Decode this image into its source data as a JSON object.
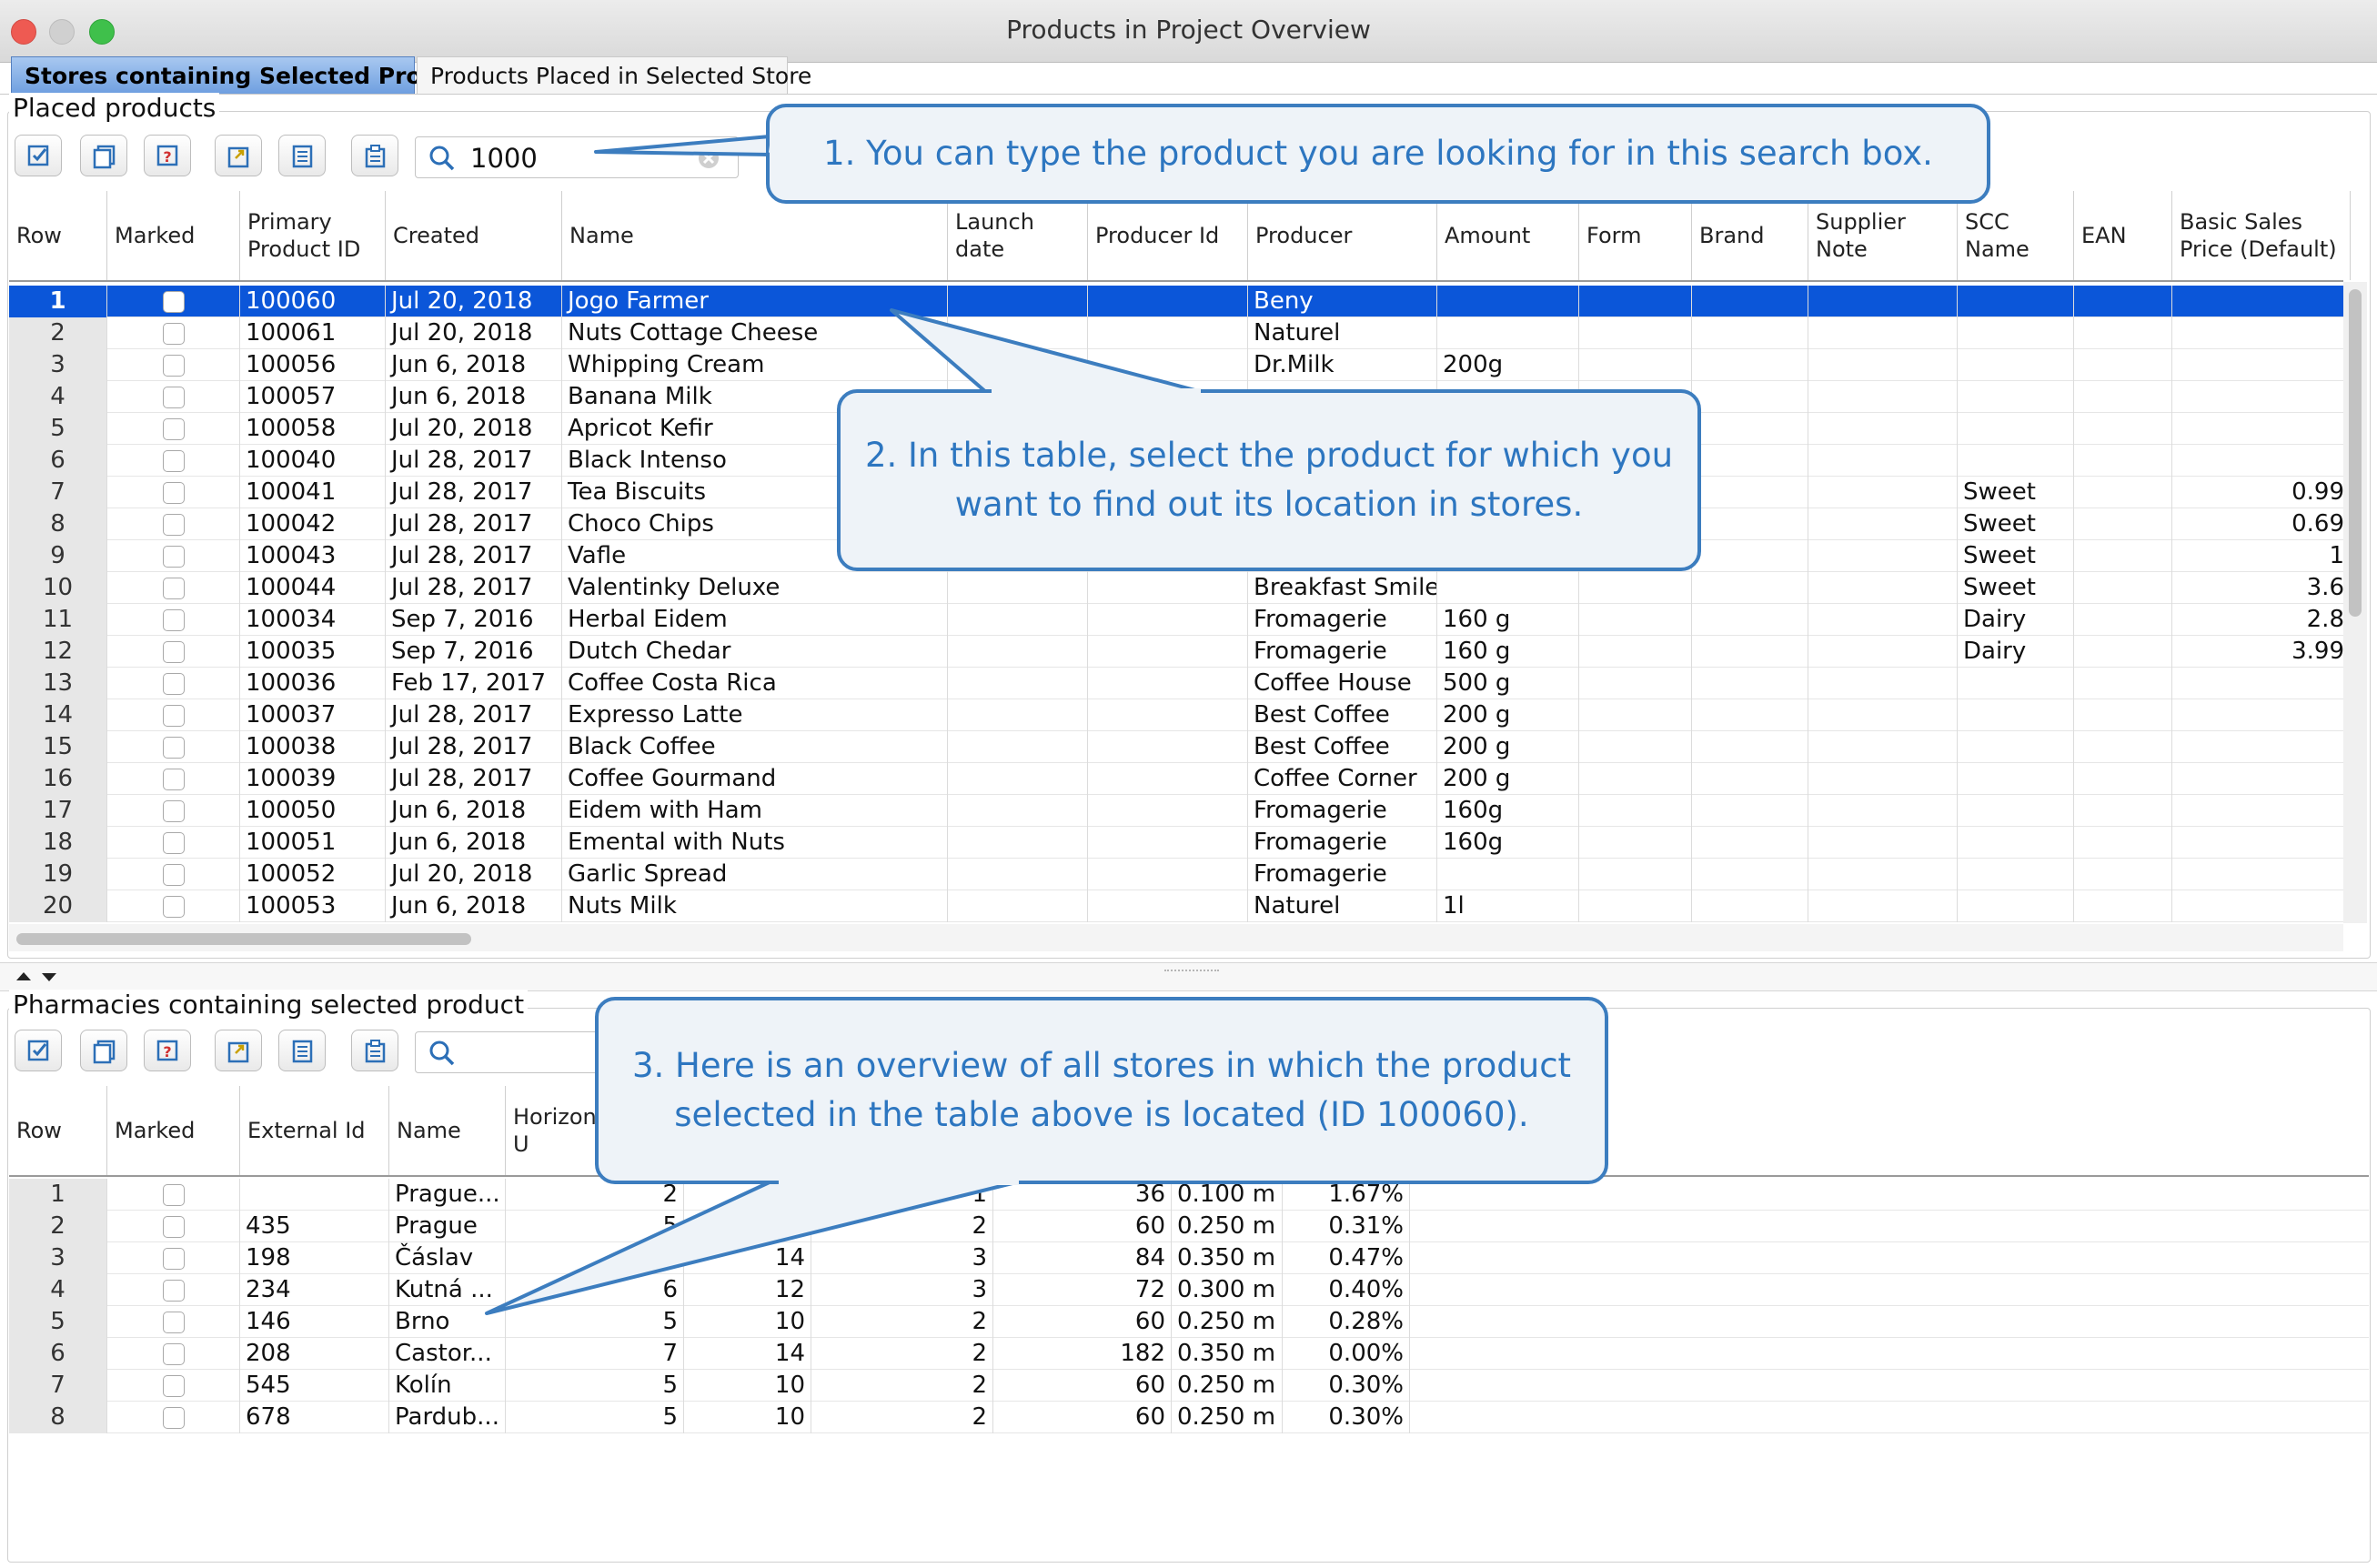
{
  "window": {
    "title": "Products in Project Overview"
  },
  "tabs": [
    {
      "label": "Stores containing Selected Product",
      "active": true
    },
    {
      "label": "Products Placed in Selected Store",
      "active": false
    }
  ],
  "top_panel": {
    "group_title": "Placed products",
    "search_value": "1000",
    "columns": [
      "Row",
      "Marked",
      "Primary Product ID",
      "Created",
      "Name",
      "Launch date",
      "Producer Id",
      "Producer",
      "Amount",
      "Form",
      "Brand",
      "Supplier Note",
      "SCC Name",
      "EAN",
      "Basic Sales Price (Default)"
    ],
    "rows": [
      {
        "row": "1",
        "id": "100060",
        "created": "Jul 20, 2018",
        "name": "Jogo Farmer",
        "producer": "Beny",
        "amount": "",
        "scc": "",
        "price": "",
        "selected": true
      },
      {
        "row": "2",
        "id": "100061",
        "created": "Jul 20, 2018",
        "name": "Nuts Cottage Cheese",
        "producer": "Naturel",
        "amount": "",
        "scc": "",
        "price": ""
      },
      {
        "row": "3",
        "id": "100056",
        "created": "Jun 6, 2018",
        "name": "Whipping Cream",
        "producer": "Dr.Milk",
        "amount": "200g",
        "scc": "",
        "price": ""
      },
      {
        "row": "4",
        "id": "100057",
        "created": "Jun 6, 2018",
        "name": "Banana Milk",
        "producer": "",
        "amount": "",
        "scc": "",
        "price": ""
      },
      {
        "row": "5",
        "id": "100058",
        "created": "Jul 20, 2018",
        "name": "Apricot Kefir",
        "producer": "",
        "amount": "",
        "scc": "",
        "price": ""
      },
      {
        "row": "6",
        "id": "100040",
        "created": "Jul 28, 2017",
        "name": "Black Intenso",
        "producer": "",
        "amount": "",
        "scc": "",
        "price": ""
      },
      {
        "row": "7",
        "id": "100041",
        "created": "Jul 28, 2017",
        "name": "Tea Biscuits",
        "producer": "",
        "amount": "",
        "scc": "Sweet",
        "price": "0.99"
      },
      {
        "row": "8",
        "id": "100042",
        "created": "Jul 28, 2017",
        "name": "Choco Chips",
        "producer": "",
        "amount": "",
        "scc": "Sweet",
        "price": "0.69"
      },
      {
        "row": "9",
        "id": "100043",
        "created": "Jul 28, 2017",
        "name": "Vafle",
        "producer": "",
        "amount": "",
        "scc": "Sweet",
        "price": "1"
      },
      {
        "row": "10",
        "id": "100044",
        "created": "Jul 28, 2017",
        "name": "Valentinky Deluxe",
        "producer": "Breakfast Smile",
        "amount": "",
        "scc": "Sweet",
        "price": "3.6"
      },
      {
        "row": "11",
        "id": "100034",
        "created": "Sep 7, 2016",
        "name": "Herbal Eidem",
        "producer": "Fromagerie",
        "amount": "160 g",
        "scc": "Dairy",
        "price": "2.8"
      },
      {
        "row": "12",
        "id": "100035",
        "created": "Sep 7, 2016",
        "name": "Dutch Chedar",
        "producer": "Fromagerie",
        "amount": "160 g",
        "scc": "Dairy",
        "price": "3.99"
      },
      {
        "row": "13",
        "id": "100036",
        "created": "Feb 17, 2017",
        "name": "Coffee Costa Rica",
        "producer": "Coffee House",
        "amount": "500 g",
        "scc": "",
        "price": ""
      },
      {
        "row": "14",
        "id": "100037",
        "created": "Jul 28, 2017",
        "name": "Expresso Latte",
        "producer": "Best Coffee",
        "amount": "200 g",
        "scc": "",
        "price": ""
      },
      {
        "row": "15",
        "id": "100038",
        "created": "Jul 28, 2017",
        "name": "Black Coffee",
        "producer": "Best Coffee",
        "amount": "200 g",
        "scc": "",
        "price": ""
      },
      {
        "row": "16",
        "id": "100039",
        "created": "Jul 28, 2017",
        "name": "Coffee Gourmand",
        "producer": "Coffee Corner",
        "amount": "200 g",
        "scc": "",
        "price": ""
      },
      {
        "row": "17",
        "id": "100050",
        "created": "Jun 6, 2018",
        "name": "Eidem with Ham",
        "producer": "Fromagerie",
        "amount": "160g",
        "scc": "",
        "price": ""
      },
      {
        "row": "18",
        "id": "100051",
        "created": "Jun 6, 2018",
        "name": "Emental with Nuts",
        "producer": "Fromagerie",
        "amount": "160g",
        "scc": "",
        "price": ""
      },
      {
        "row": "19",
        "id": "100052",
        "created": "Jul 20, 2018",
        "name": "Garlic Spread",
        "producer": "Fromagerie",
        "amount": "",
        "scc": "",
        "price": ""
      },
      {
        "row": "20",
        "id": "100053",
        "created": "Jun 6, 2018",
        "name": "Nuts Milk",
        "producer": "Naturel",
        "amount": "1l",
        "scc": "",
        "price": ""
      }
    ]
  },
  "bottom_panel": {
    "group_title": "Pharmacies containing selected product",
    "search_value": "",
    "columns": [
      "Row",
      "Marked",
      "External Id",
      "Name",
      "Horizon Basic U"
    ],
    "rows": [
      {
        "row": "1",
        "ext": "",
        "name": "Prague...",
        "a": "2",
        "b": "",
        "c": "1",
        "d": "36",
        "e": "0.100 m",
        "f": "1.67%"
      },
      {
        "row": "2",
        "ext": "435",
        "name": "Prague",
        "a": "5",
        "b": "",
        "c": "2",
        "d": "60",
        "e": "0.250 m",
        "f": "0.31%"
      },
      {
        "row": "3",
        "ext": "198",
        "name": "Čáslav",
        "a": "",
        "b": "14",
        "c": "3",
        "d": "84",
        "e": "0.350 m",
        "f": "0.47%"
      },
      {
        "row": "4",
        "ext": "234",
        "name": "Kutná ...",
        "a": "6",
        "b": "12",
        "c": "3",
        "d": "72",
        "e": "0.300 m",
        "f": "0.40%"
      },
      {
        "row": "5",
        "ext": "146",
        "name": "Brno",
        "a": "5",
        "b": "10",
        "c": "2",
        "d": "60",
        "e": "0.250 m",
        "f": "0.28%"
      },
      {
        "row": "6",
        "ext": "208",
        "name": "Castor...",
        "a": "7",
        "b": "14",
        "c": "2",
        "d": "182",
        "e": "0.350 m",
        "f": "0.00%"
      },
      {
        "row": "7",
        "ext": "545",
        "name": "Kolín",
        "a": "5",
        "b": "10",
        "c": "2",
        "d": "60",
        "e": "0.250 m",
        "f": "0.30%"
      },
      {
        "row": "8",
        "ext": "678",
        "name": "Pardub...",
        "a": "5",
        "b": "10",
        "c": "2",
        "d": "60",
        "e": "0.250 m",
        "f": "0.30%"
      }
    ]
  },
  "callouts": {
    "c1": "1. You can type the product you are looking for in this search box.",
    "c2": "2. In this table, select the product for which you want to find out its location in stores.",
    "c3": "3. Here is an overview of all stores in which the product selected in the table above is located (ID 100060)."
  },
  "colors": {
    "selection": "#0b56d9",
    "callout_border": "#3c7dbf",
    "callout_text": "#2d76c0",
    "callout_fill": "#eef3f8"
  }
}
